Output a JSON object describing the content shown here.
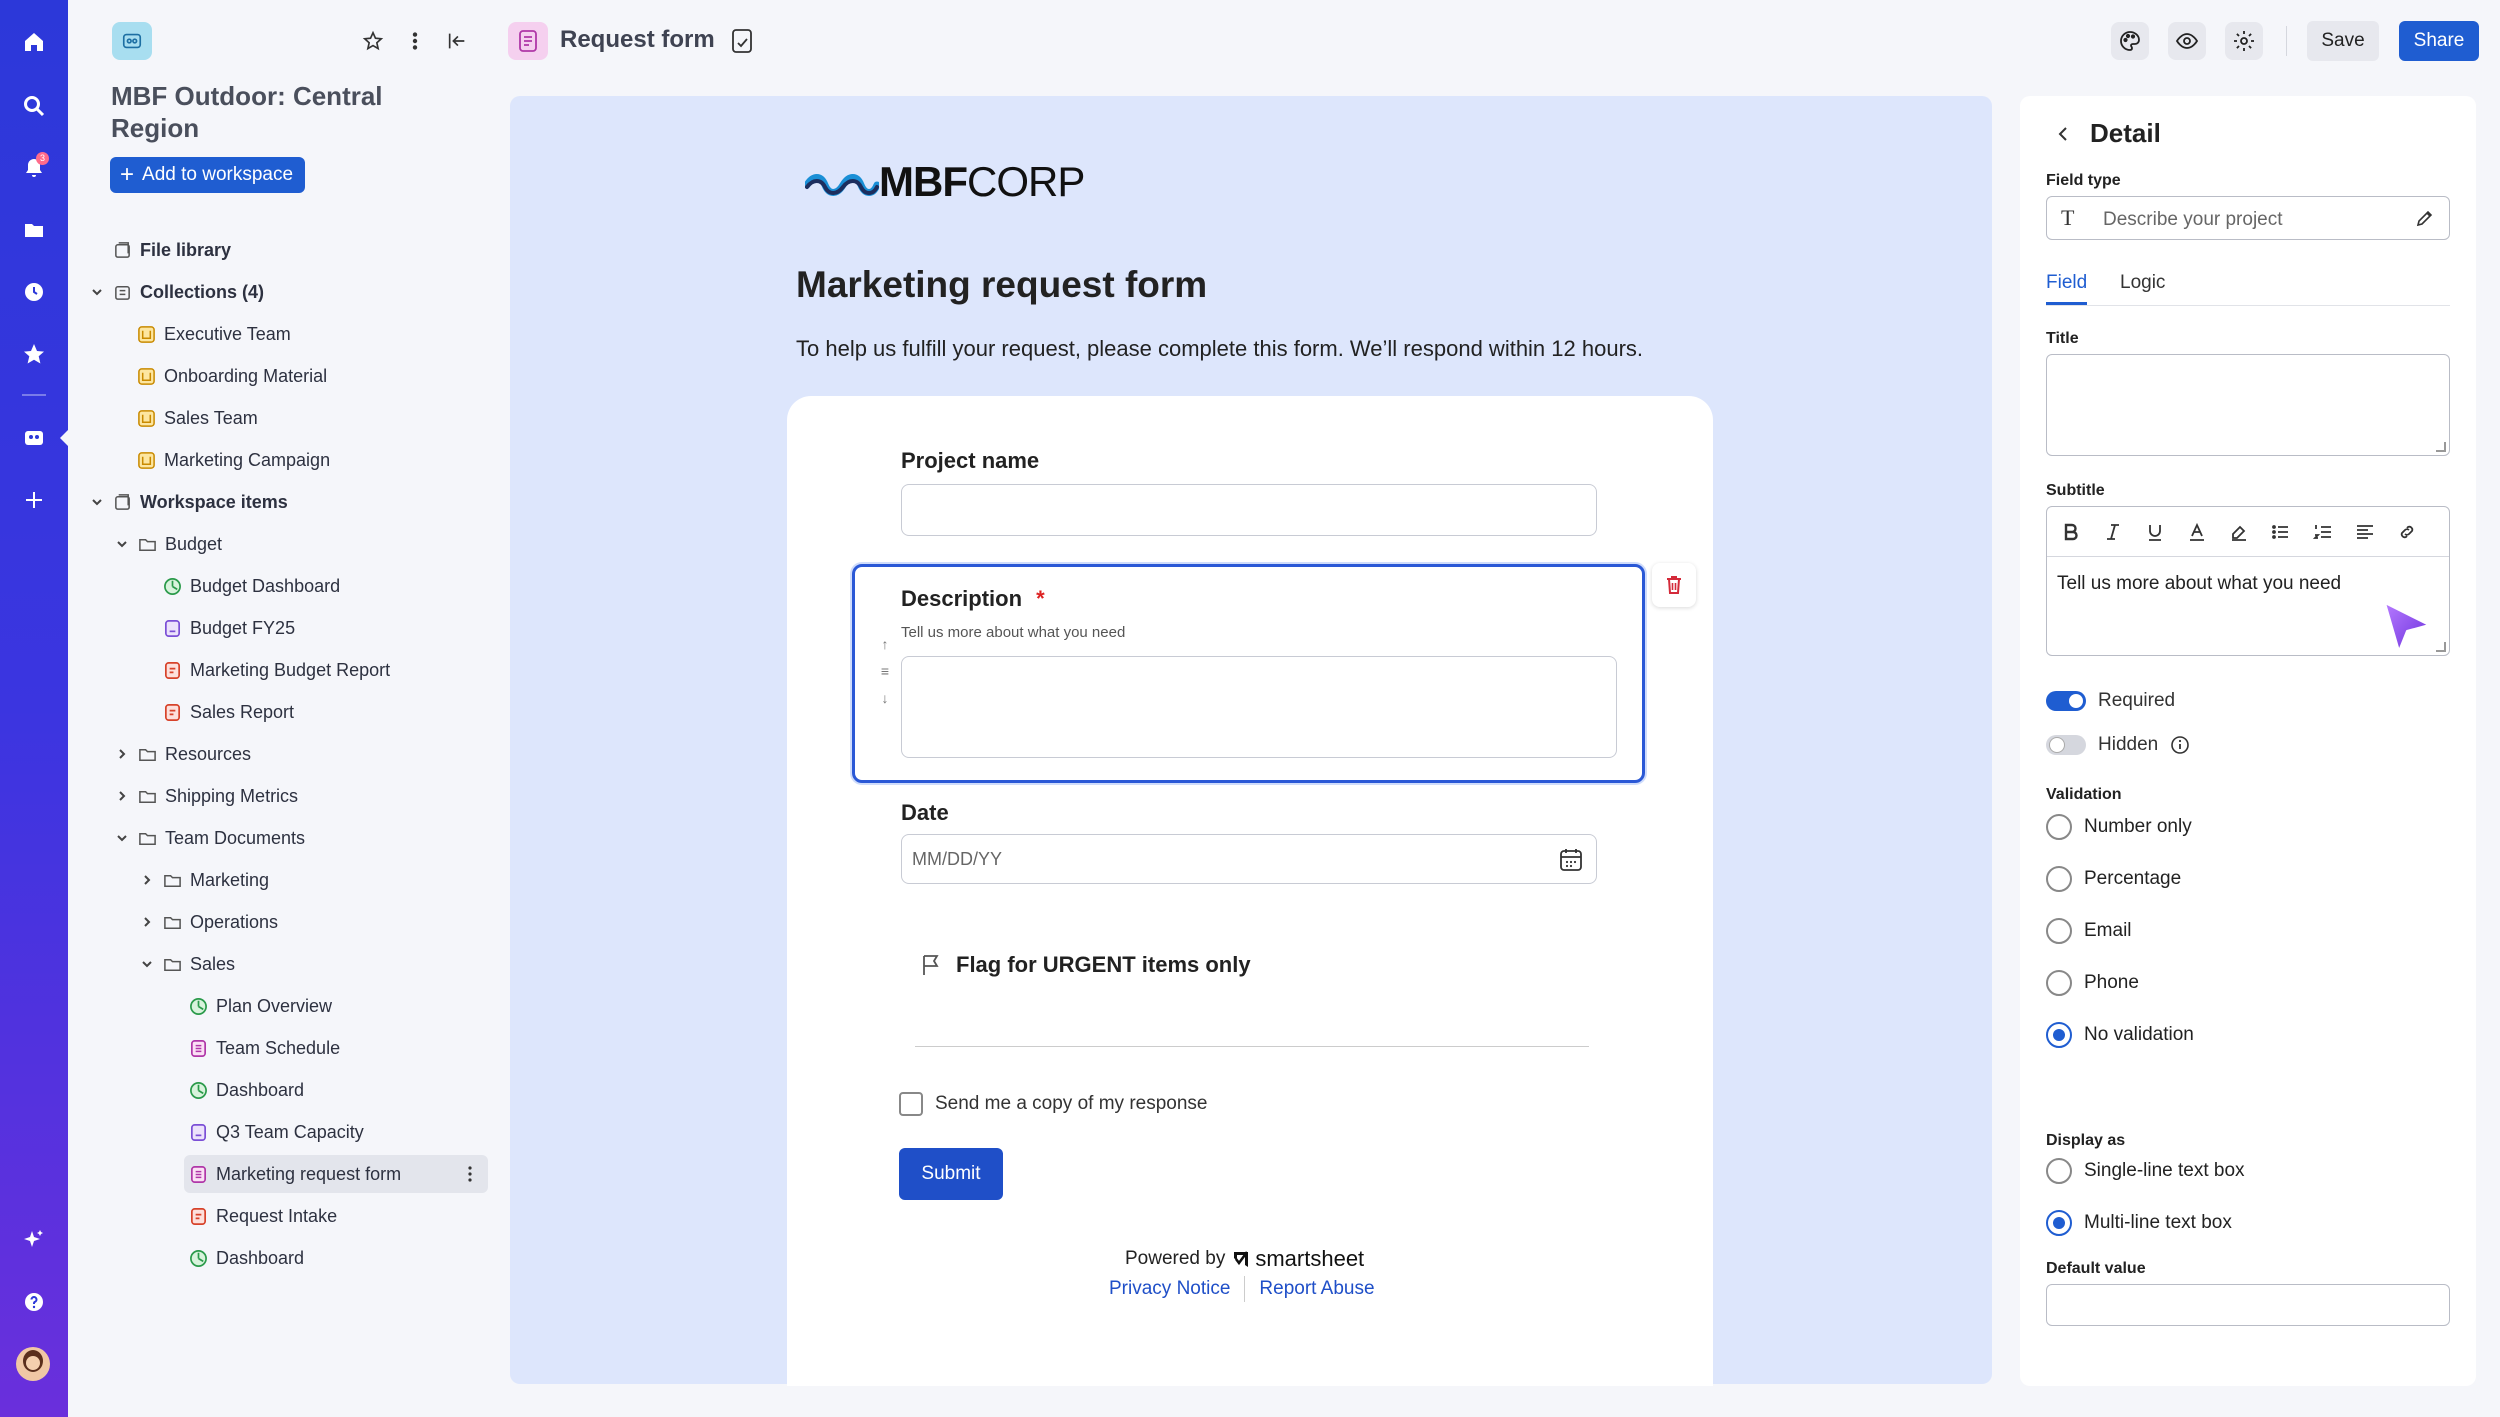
{
  "rail": {
    "notification_count": "3"
  },
  "sidebar": {
    "workspace_title": "MBF Outdoor: Central Region",
    "add_button": "Add to workspace",
    "items": [
      {
        "label": "File library",
        "icon": "file-library-icon"
      },
      {
        "label": "Collections (4)",
        "icon": "collection-icon"
      },
      {
        "label": "Executive Team",
        "icon": "collection-item-icon"
      },
      {
        "label": "Onboarding Material",
        "icon": "collection-item-icon"
      },
      {
        "label": "Sales Team",
        "icon": "collection-item-icon"
      },
      {
        "label": "Marketing Campaign",
        "icon": "collection-item-icon"
      },
      {
        "label": "Workspace items",
        "icon": "workspace-items-icon"
      },
      {
        "label": "Budget",
        "icon": "folder-icon"
      },
      {
        "label": "Budget Dashboard",
        "icon": "dashboard-icon"
      },
      {
        "label": "Budget FY25",
        "icon": "sheet-icon"
      },
      {
        "label": "Marketing Budget Report",
        "icon": "report-icon"
      },
      {
        "label": "Sales Report",
        "icon": "report-icon"
      },
      {
        "label": "Resources",
        "icon": "folder-icon"
      },
      {
        "label": "Shipping Metrics",
        "icon": "folder-icon"
      },
      {
        "label": "Team Documents",
        "icon": "folder-icon"
      },
      {
        "label": "Marketing",
        "icon": "folder-icon"
      },
      {
        "label": "Operations",
        "icon": "folder-icon"
      },
      {
        "label": "Sales",
        "icon": "folder-icon"
      },
      {
        "label": "Plan Overview",
        "icon": "dashboard-icon"
      },
      {
        "label": "Team Schedule",
        "icon": "form-icon"
      },
      {
        "label": "Dashboard",
        "icon": "dashboard-icon"
      },
      {
        "label": "Q3 Team Capacity",
        "icon": "sheet-icon"
      },
      {
        "label": "Marketing request form",
        "icon": "form-icon"
      },
      {
        "label": "Request Intake",
        "icon": "report-icon"
      },
      {
        "label": "Dashboard",
        "icon": "dashboard-icon"
      }
    ]
  },
  "topbar": {
    "title": "Request form",
    "save_label": "Save",
    "share_label": "Share"
  },
  "form": {
    "logo_bold": "MBF",
    "logo_light": "CORP",
    "title": "Marketing request form",
    "subtitle": "To help us fulfill your request, please complete this form. We’ll respond within 12 hours.",
    "fields": {
      "project_name": "Project name",
      "description": "Description",
      "required_mark": "*",
      "description_help": "Tell us more about what you need",
      "date": "Date",
      "date_placeholder": "MM/DD/YY",
      "flag": "Flag for URGENT items only"
    },
    "copy_label": "Send me a copy of my response",
    "submit_label": "Submit",
    "powered_by": "Powered by",
    "brand": "smartsheet",
    "privacy": "Privacy Notice",
    "abuse": "Report Abuse"
  },
  "detail": {
    "title": "Detail",
    "field_type_label": "Field type",
    "field_type_value": "Describe your project",
    "tabs": [
      "Field",
      "Logic"
    ],
    "title_label": "Title",
    "title_value": "",
    "subtitle_label": "Subtitle",
    "subtitle_value": "Tell us more about what you need",
    "required_label": "Required",
    "hidden_label": "Hidden",
    "validation_label": "Validation",
    "validation_options": [
      "Number only",
      "Percentage",
      "Email",
      "Phone",
      "No validation"
    ],
    "validation_selected": "No validation",
    "display_label": "Display as",
    "display_options": [
      "Single-line text box",
      "Multi-line text box"
    ],
    "display_selected": "Multi-line text box",
    "default_label": "Default value",
    "default_value": ""
  },
  "colors": {
    "accent": "#1f5dd1",
    "canvas": "#dde6fc",
    "rail_top": "#2c38d9",
    "rail_bottom": "#6a2fdc"
  }
}
